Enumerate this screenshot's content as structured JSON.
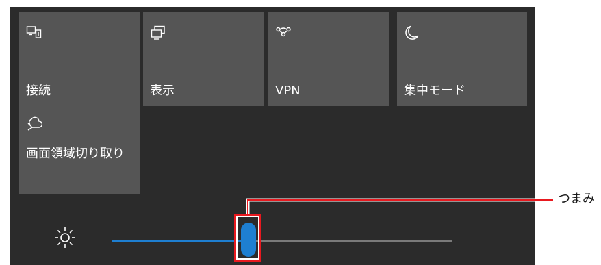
{
  "tiles": {
    "connect": {
      "label": "接続",
      "icon": "cast-icon"
    },
    "display": {
      "label": "表示",
      "icon": "project-icon"
    },
    "vpn": {
      "label": "VPN",
      "icon": "vpn-icon"
    },
    "focus": {
      "label": "集中モード",
      "icon": "moon-icon"
    },
    "snip": {
      "label": "画面領域切り取り",
      "icon": "snip-icon"
    }
  },
  "brightness": {
    "icon": "sun-icon",
    "level": 0.4
  },
  "callout": {
    "label": "つまみ"
  },
  "colors": {
    "panel_bg": "#2b2b2b",
    "tile_bg": "#555555",
    "accent": "#1e7fd1",
    "highlight": "#e8191f"
  }
}
